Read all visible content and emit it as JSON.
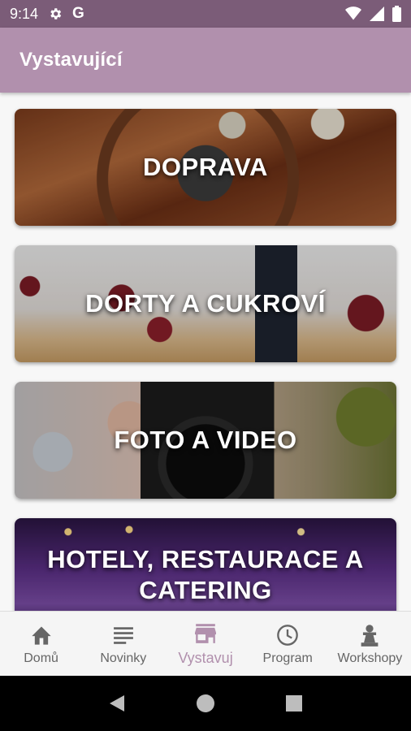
{
  "status_bar": {
    "time": "9:14",
    "google_letter": "G"
  },
  "app_bar": {
    "title": "Vystavující"
  },
  "categories": [
    {
      "label": "DOPRAVA"
    },
    {
      "label": "DORTY A CUKROVÍ"
    },
    {
      "label": "FOTO A VIDEO"
    },
    {
      "label": "HOTELY, RESTAURACE A CATERING"
    }
  ],
  "bottom_nav": {
    "items": [
      {
        "label": "Domů",
        "icon": "home-icon"
      },
      {
        "label": "Novinky",
        "icon": "news-icon"
      },
      {
        "label": "Vystavuj",
        "icon": "store-icon",
        "active": true
      },
      {
        "label": "Program",
        "icon": "clock-icon"
      },
      {
        "label": "Workshopy",
        "icon": "chess-pawn-icon"
      }
    ]
  },
  "colors": {
    "status_bar": "#7b5c78",
    "app_bar": "#b190ad",
    "accent": "#b190ad",
    "nav_inactive": "#666666"
  }
}
